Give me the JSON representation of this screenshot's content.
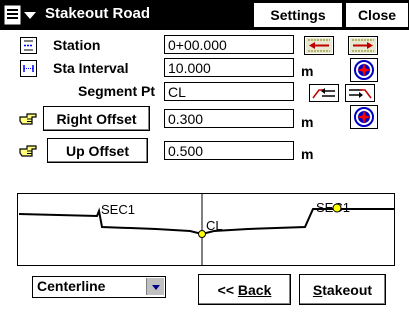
{
  "window": {
    "title": "Stakeout Road",
    "settings_label": "Settings",
    "close_label": "Close"
  },
  "station": {
    "label": "Station",
    "value": "0+00.000"
  },
  "sta_interval": {
    "label": "Sta Interval",
    "value": "10.000",
    "unit": "m"
  },
  "segment_pt": {
    "label": "Segment Pt",
    "value": "CL"
  },
  "right_offset": {
    "label": "Right Offset",
    "value": "0.300",
    "unit": "m"
  },
  "up_offset": {
    "label": "Up Offset",
    "value": "0.500",
    "unit": "m"
  },
  "profile": {
    "left_label": "SEC1",
    "center_label": "CL",
    "right_label": "SEC1"
  },
  "footer": {
    "mode_value": "Centerline",
    "back_arrows": "<< ",
    "back_label": "Back",
    "stakeout_label": "Stakeout"
  },
  "icons": [
    "menu-icon",
    "station-icon",
    "interval-icon",
    "prev-station-icon",
    "next-station-icon",
    "compass-icon",
    "segment-prev-icon",
    "segment-next-icon",
    "hand-pointer-icon",
    "dropdown-arrow-icon"
  ]
}
